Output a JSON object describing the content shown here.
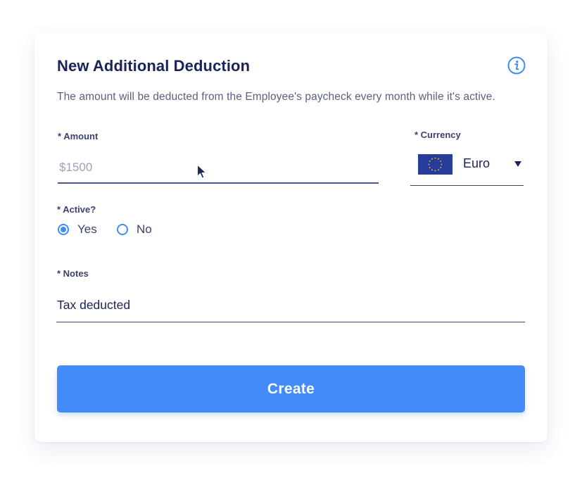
{
  "dialog": {
    "title": "New Additional Deduction",
    "subtitle": "The amount will be deducted from the Employee's paycheck every month while it's active.",
    "info_icon": "info-icon"
  },
  "amount": {
    "label": "* Amount",
    "placeholder": "$1500",
    "value": ""
  },
  "currency": {
    "label": "* Currency",
    "selected": "Euro",
    "flag_icon": "eu-flag-icon",
    "dropdown_icon": "chevron-down-icon"
  },
  "active": {
    "label": "* Active?",
    "options": [
      {
        "label": "Yes",
        "selected": true
      },
      {
        "label": "No",
        "selected": false
      }
    ]
  },
  "notes": {
    "label": "* Notes",
    "value": "Tax deducted"
  },
  "actions": {
    "create_label": "Create"
  },
  "colors": {
    "accent": "#448bfa",
    "radio": "#3d8cf6",
    "title_text": "#1b2357",
    "body_text": "#5b5f82",
    "flag_blue": "#283c9c",
    "flag_stars": "#f5d400"
  }
}
